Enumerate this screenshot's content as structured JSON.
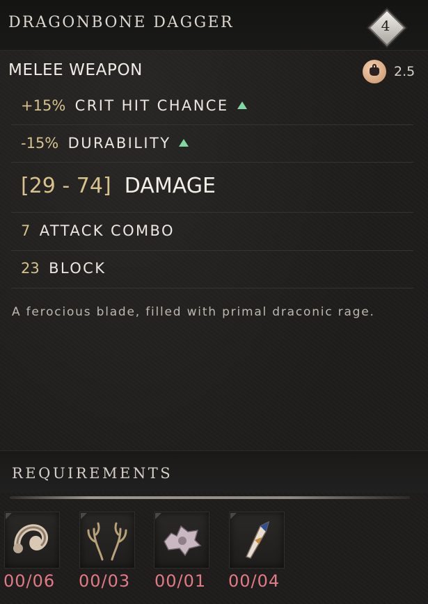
{
  "item": {
    "name": "DRAGONBONE DAGGER",
    "level": "4",
    "type": "MELEE WEAPON",
    "weight": "2.5"
  },
  "stats": {
    "crit": {
      "value": "+15%",
      "label": "CRIT HIT CHANCE",
      "trend": "up"
    },
    "durability": {
      "value": "-15%",
      "label": "DURABILITY",
      "trend": "up"
    },
    "damage": {
      "value": "[29 - 74]",
      "label": "DAMAGE"
    },
    "combo": {
      "value": "7",
      "label": "ATTACK COMBO"
    },
    "block": {
      "value": "23",
      "label": "BLOCK"
    }
  },
  "description": "A ferocious blade, filled with primal draconic rage.",
  "requirements": {
    "title": "REQUIREMENTS",
    "items": [
      {
        "icon": "horn-icon",
        "count": "00/06"
      },
      {
        "icon": "antlers-icon",
        "count": "00/03"
      },
      {
        "icon": "bone-icon",
        "count": "00/01"
      },
      {
        "icon": "fang-icon",
        "count": "00/04"
      }
    ]
  },
  "colors": {
    "stat_number": "#d6c28a",
    "trend_up": "#7fd9a3",
    "requirement_missing": "#e27a86"
  }
}
